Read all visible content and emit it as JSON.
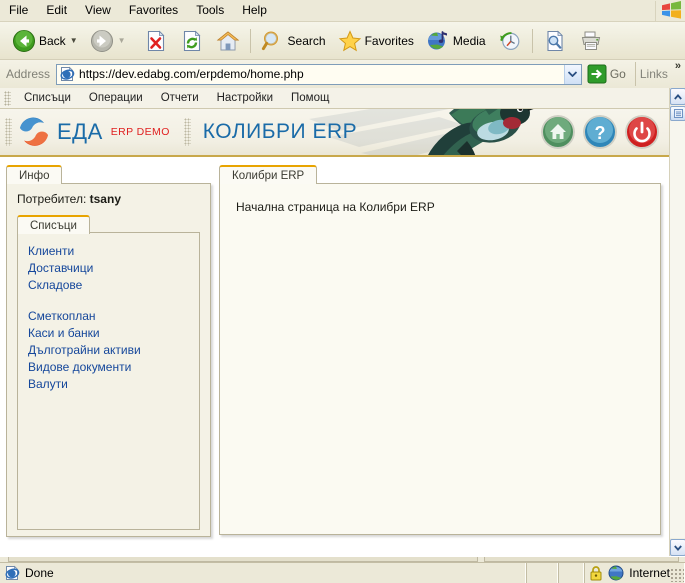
{
  "browser": {
    "menu": [
      {
        "label": "File"
      },
      {
        "label": "Edit"
      },
      {
        "label": "View"
      },
      {
        "label": "Favorites"
      },
      {
        "label": "Tools"
      },
      {
        "label": "Help"
      }
    ],
    "toolbar": {
      "back_label": "Back",
      "forward_label": "",
      "search_label": "Search",
      "favorites_label": "Favorites",
      "media_label": "Media"
    },
    "address": {
      "label": "Address",
      "url": "https://dev.edabg.com/erpdemo/home.php",
      "placeholder": "https://",
      "go_label": "Go",
      "links_label": "Links",
      "more_chevron": "»"
    },
    "status": {
      "text": "Done",
      "zone": "Internet"
    }
  },
  "app": {
    "menu": [
      {
        "label": "Списъци"
      },
      {
        "label": "Операции"
      },
      {
        "label": "Отчети"
      },
      {
        "label": "Настройки"
      },
      {
        "label": "Помощ"
      }
    ],
    "brand": {
      "name": "ЕДА",
      "tagline": "ERP DEMO",
      "title": "КОЛИБРИ ERP"
    },
    "sidebar": {
      "tab_label": "Инфо",
      "user_prefix": "Потребител:",
      "user_name": "tsany",
      "lists_tab_label": "Списъци",
      "links_group_1": [
        {
          "label": "Клиенти"
        },
        {
          "label": "Доставчици"
        },
        {
          "label": "Складове"
        }
      ],
      "links_group_2": [
        {
          "label": "Сметкоплан"
        },
        {
          "label": "Каси и банки"
        },
        {
          "label": "Дълготрайни активи"
        },
        {
          "label": "Видове документи"
        },
        {
          "label": "Валути"
        }
      ]
    },
    "content": {
      "tab_label": "Колибри ERP",
      "body_text": "Начална страница на Колибри  ERP"
    },
    "actions": [
      {
        "name": "home-button"
      },
      {
        "name": "help-button"
      },
      {
        "name": "logout-button"
      }
    ]
  },
  "colors": {
    "brand_blue": "#1a6ba8",
    "brand_red": "#e02020",
    "tab_accent": "#e8a400",
    "link_blue": "#15479b",
    "chrome_bg": "#ece9d8"
  }
}
